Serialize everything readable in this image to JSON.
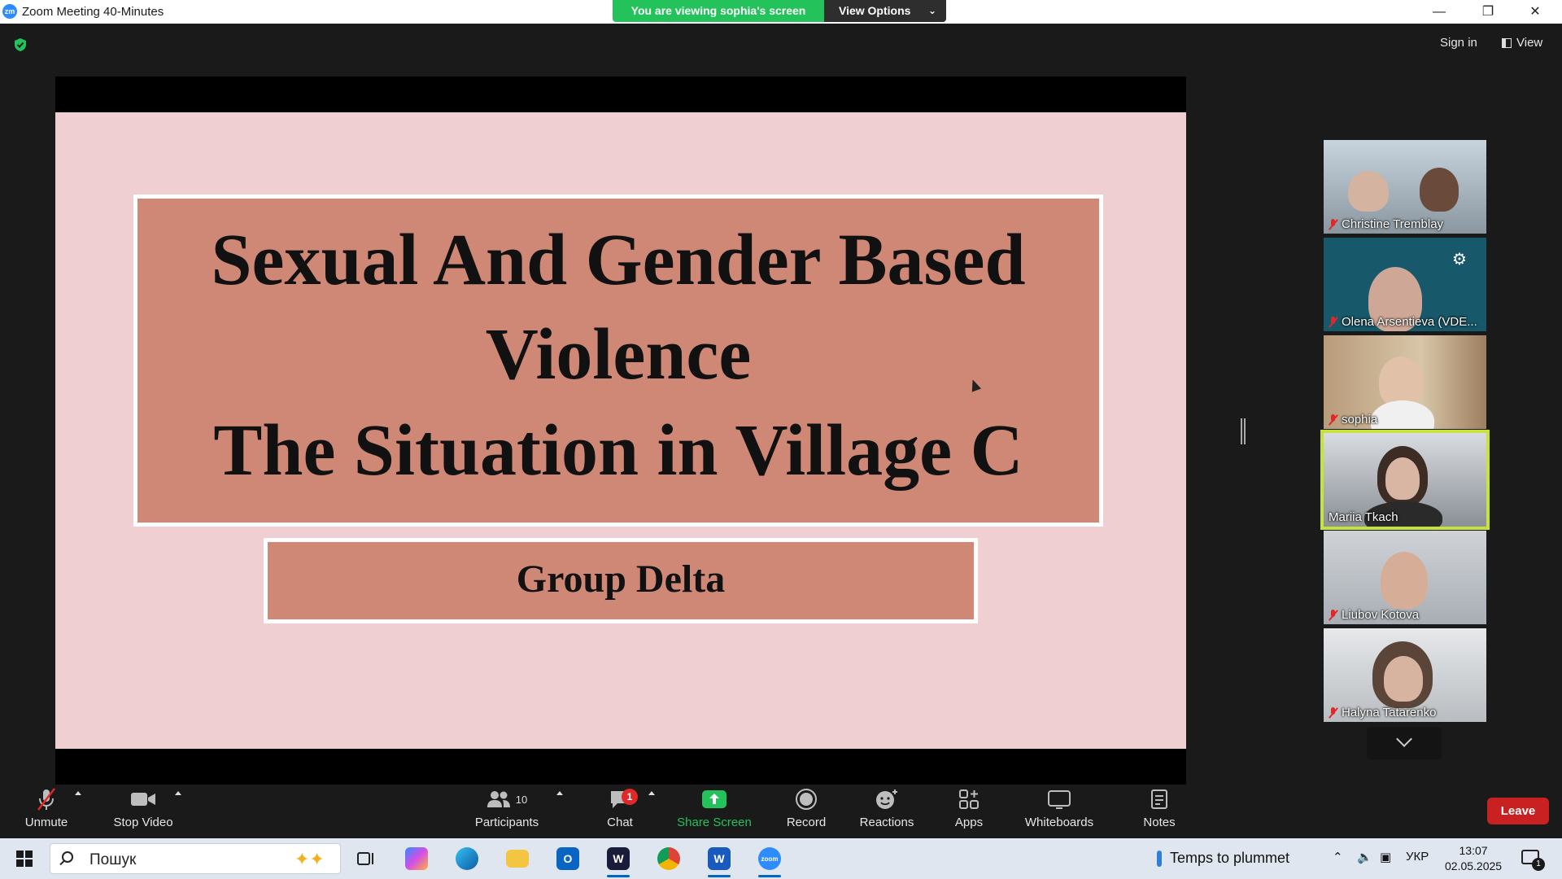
{
  "window": {
    "title": "Zoom Meeting 40-Minutes",
    "app_icon_label": "zm"
  },
  "share_banner": {
    "status": "You are viewing sophia's screen",
    "view_options": "View Options"
  },
  "header": {
    "sign_in": "Sign in",
    "view": "View"
  },
  "slide": {
    "title_line1": "Sexual And Gender Based",
    "title_line2": "Violence",
    "title_line3": "The Situation in Village C",
    "subtitle": "Group Delta"
  },
  "participants": [
    {
      "name": "Christine Tremblay",
      "muted": true,
      "active": false
    },
    {
      "name": "Olena Arsentieva (VDE...",
      "muted": true,
      "active": false
    },
    {
      "name": "sophia",
      "muted": true,
      "active": false
    },
    {
      "name": "Mariia Tkach",
      "muted": false,
      "active": true
    },
    {
      "name": "Liubov Kotova",
      "muted": true,
      "active": false
    },
    {
      "name": "Halyna Tatarenko",
      "muted": true,
      "active": false
    }
  ],
  "toolbar": {
    "unmute": "Unmute",
    "stop_video": "Stop Video",
    "participants": "Participants",
    "participants_count": "10",
    "chat": "Chat",
    "chat_badge": "1",
    "share_screen": "Share Screen",
    "record": "Record",
    "reactions": "Reactions",
    "apps": "Apps",
    "whiteboards": "Whiteboards",
    "notes": "Notes",
    "leave": "Leave"
  },
  "taskbar": {
    "search_placeholder": "Пошук",
    "weather": "Temps to plummet",
    "language": "УКР",
    "time": "13:07",
    "date": "02.05.2025",
    "notification_count": "1"
  },
  "colors": {
    "accent_green": "#23c25b",
    "leave_red": "#c92121",
    "slide_background": "#efcfd2",
    "slide_box": "#d08876",
    "active_speaker": "#c8e23c"
  }
}
